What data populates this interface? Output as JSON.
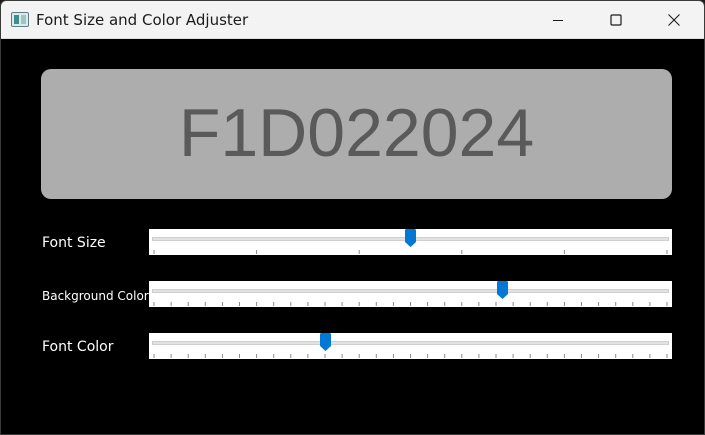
{
  "window": {
    "title": "Font Size and Color Adjuster",
    "icon": "app-window-icon",
    "controls": [
      "minimize-icon",
      "maximize-icon",
      "close-icon"
    ]
  },
  "display": {
    "text": "F1D022024",
    "background_color": "#adadad",
    "text_color": "#5a5a5a"
  },
  "sliders": [
    {
      "label": "Font Size",
      "value_fraction": 0.5,
      "tick_count": 5,
      "accent": "#0078d4"
    },
    {
      "label": "Background Color",
      "value_fraction": 0.68,
      "tick_count": 30,
      "accent": "#0078d4"
    },
    {
      "label": "Font Color",
      "value_fraction": 0.335,
      "tick_count": 30,
      "accent": "#0078d4"
    }
  ]
}
